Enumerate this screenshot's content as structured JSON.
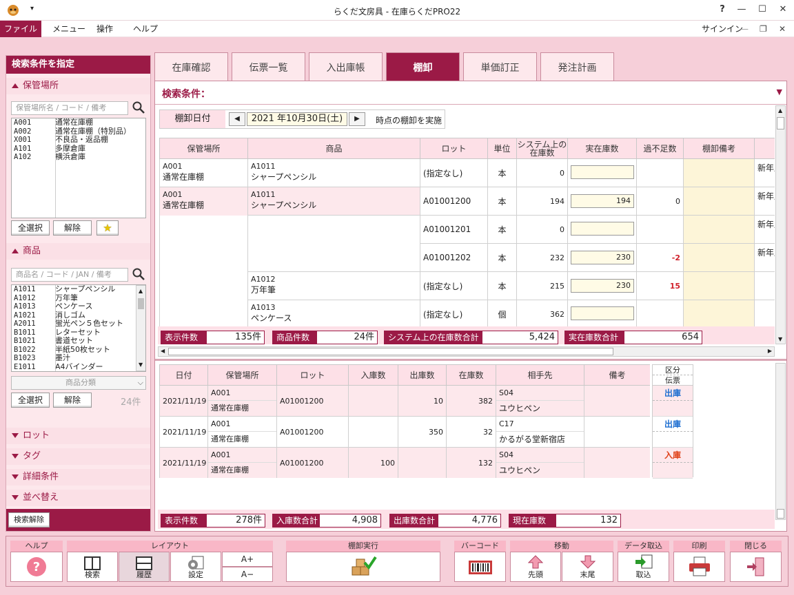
{
  "window": {
    "title": "らくだ文房具 - 在庫らくだPRO22",
    "help": "?",
    "minimize": "—",
    "maximize": "☐",
    "close": "✕"
  },
  "menu": {
    "file": "ファイル",
    "menu": "メニュー",
    "ops": "操作",
    "help": "ヘルプ",
    "signin": "サインイン"
  },
  "left": {
    "header": "検索条件を指定",
    "location_section": "保管場所",
    "location_placeholder": "保管場所名 / コード / 備考",
    "locations": [
      {
        "code": "A001",
        "name": "通常在庫棚"
      },
      {
        "code": "A002",
        "name": "通常在庫棚（特別品）"
      },
      {
        "code": "X001",
        "name": "不良品・返品棚"
      },
      {
        "code": "A101",
        "name": "多摩倉庫"
      },
      {
        "code": "A102",
        "name": "横浜倉庫"
      }
    ],
    "select_all": "全選択",
    "clear": "解除",
    "product_section": "商品",
    "product_placeholder": "商品名 / コード / JAN / 備考",
    "products": [
      {
        "code": "A1011",
        "name": "シャープペンシル"
      },
      {
        "code": "A1012",
        "name": "万年筆"
      },
      {
        "code": "A1013",
        "name": "ペンケース"
      },
      {
        "code": "A1021",
        "name": "消しゴム"
      },
      {
        "code": "A2011",
        "name": "蛍光ペン５色セット"
      },
      {
        "code": "B1011",
        "name": "レターセット"
      },
      {
        "code": "B1021",
        "name": "書道セット"
      },
      {
        "code": "B1022",
        "name": "半紙50枚セット"
      },
      {
        "code": "B1023",
        "name": "墨汁"
      },
      {
        "code": "E1011",
        "name": "A4バインダー"
      }
    ],
    "category_placeholder": "商品分類",
    "product_count": "24件",
    "lot_section": "ロット",
    "tag_section": "タグ",
    "detail_section": "詳細条件",
    "sort_section": "並べ替え",
    "reset": "検索解除"
  },
  "tabs": [
    "在庫確認",
    "伝票一覧",
    "入出庫帳",
    "棚卸",
    "単価訂正",
    "発注計画"
  ],
  "active_tab": 3,
  "condition_label": "検索条件：",
  "date_bar": {
    "label": "棚卸日付",
    "date": "2021 年10月30日(土)",
    "note": "時点の棚卸を実施"
  },
  "inv_headers": [
    "保管場所",
    "商品",
    "ロット",
    "単位",
    "システム上の在庫数",
    "実在庫数",
    "過不足数",
    "棚卸備考",
    ""
  ],
  "inv_rows": [
    {
      "loc_code": "A001",
      "loc_name": "通常在庫棚",
      "prod_code": "A1011",
      "prod_name": "シャープペンシル",
      "lot": "(指定なし)",
      "unit": "本",
      "sys": "0",
      "actual": "",
      "diff": "",
      "extra": "新年度"
    },
    {
      "loc_code": "A001",
      "loc_name": "通常在庫棚",
      "prod_code": "A1011",
      "prod_name": "シャープペンシル",
      "lot": "A01001200",
      "unit": "本",
      "sys": "194",
      "actual": "194",
      "diff": "0",
      "extra": "新年度"
    },
    {
      "loc_code": "",
      "loc_name": "",
      "prod_code": "",
      "prod_name": "",
      "lot": "A01001201",
      "unit": "本",
      "sys": "0",
      "actual": "",
      "diff": "",
      "extra": "新年度"
    },
    {
      "loc_code": "",
      "loc_name": "",
      "prod_code": "",
      "prod_name": "",
      "lot": "A01001202",
      "unit": "本",
      "sys": "232",
      "actual": "230",
      "diff": "-2",
      "extra": "新年度"
    },
    {
      "loc_code": "",
      "loc_name": "",
      "prod_code": "A1012",
      "prod_name": "万年筆",
      "lot": "(指定なし)",
      "unit": "本",
      "sys": "215",
      "actual": "230",
      "diff": "15",
      "extra": ""
    },
    {
      "loc_code": "",
      "loc_name": "",
      "prod_code": "A1013",
      "prod_name": "ペンケース",
      "lot": "(指定なし)",
      "unit": "個",
      "sys": "362",
      "actual": "",
      "diff": "",
      "extra": ""
    }
  ],
  "inv_summary": {
    "count_label": "表示件数",
    "count": "135件",
    "prod_label": "商品件数",
    "prod": "24件",
    "sys_label": "システム上の在庫数合計",
    "sys": "5,424",
    "actual_label": "実在庫数合計",
    "actual": "654"
  },
  "hist_headers": [
    "日付",
    "保管場所",
    "ロット",
    "入庫数",
    "出庫数",
    "在庫数",
    "相手先",
    "備考"
  ],
  "hist_side_header": [
    "区分",
    "伝票"
  ],
  "hist_rows": [
    {
      "date": "2021/11/19",
      "loc_code": "A001",
      "loc_name": "通常在庫棚",
      "lot": "A01001200",
      "in": "",
      "out": "10",
      "stock": "382",
      "partner_code": "S04",
      "partner_name": "ユウヒペン",
      "note": "",
      "kind": "出庫",
      "kind_color": "#1f6fd1"
    },
    {
      "date": "2021/11/19",
      "loc_code": "A001",
      "loc_name": "通常在庫棚",
      "lot": "A01001200",
      "in": "",
      "out": "350",
      "stock": "32",
      "partner_code": "C17",
      "partner_name": "かるがる堂新宿店",
      "note": "",
      "kind": "出庫",
      "kind_color": "#1f6fd1"
    },
    {
      "date": "2021/11/19",
      "loc_code": "A001",
      "loc_name": "通常在庫棚",
      "lot": "A01001200",
      "in": "100",
      "out": "",
      "stock": "132",
      "partner_code": "S04",
      "partner_name": "ユウヒペン",
      "note": "",
      "kind": "入庫",
      "kind_color": "#e0421a"
    }
  ],
  "hist_summary": {
    "count_label": "表示件数",
    "count": "278件",
    "in_label": "入庫数合計",
    "in": "4,908",
    "out_label": "出庫数合計",
    "out": "4,776",
    "stock_label": "現在庫数",
    "stock": "132"
  },
  "toolbar": {
    "help_h": "ヘルプ",
    "layout_h": "レイアウト",
    "search": "検索",
    "history": "履歴",
    "settings": "設定",
    "font_up": "A+",
    "font_down": "A−",
    "exec_h": "棚卸実行",
    "barcode_h": "バーコード",
    "move_h": "移動",
    "first": "先頭",
    "last": "末尾",
    "import_h": "データ取込",
    "import": "取込",
    "print_h": "印刷",
    "close_h": "閉じる"
  }
}
